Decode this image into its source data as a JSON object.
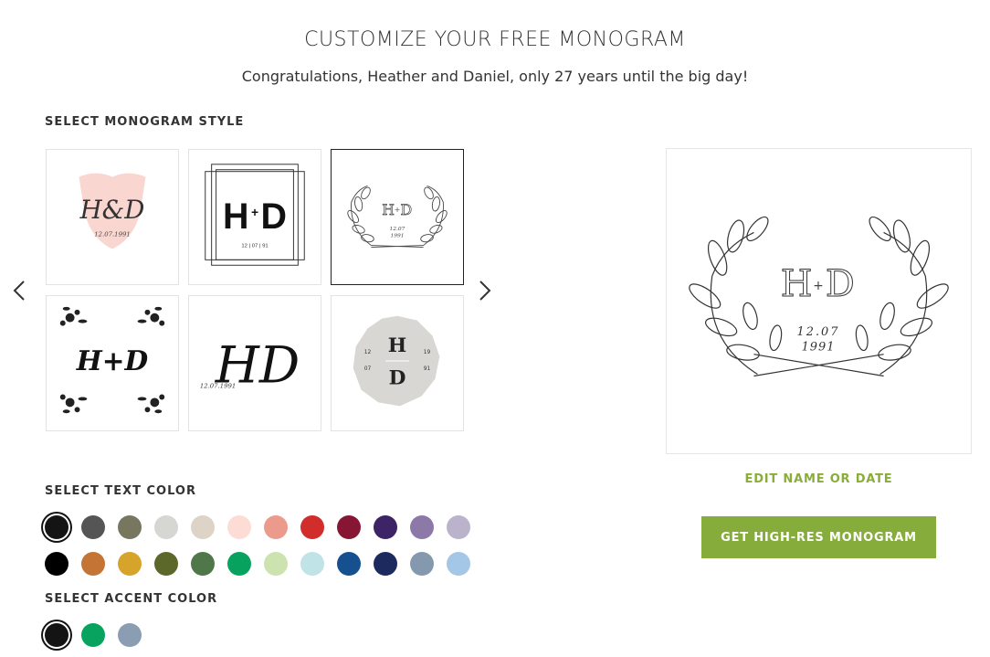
{
  "header": {
    "title": "CUSTOMIZE YOUR FREE MONOGRAM",
    "subtitle": "Congratulations, Heather and Daniel, only 27 years until the big day!"
  },
  "style_section": {
    "label": "SELECT MONOGRAM STYLE",
    "prev_icon": "chevron-left-icon",
    "next_icon": "chevron-right-icon",
    "selected_index": 2,
    "tiles": [
      {
        "name": "pink-shield",
        "initials": "H&D",
        "date": "12.07.1991"
      },
      {
        "name": "block-square",
        "initials_left": "H",
        "initials_right": "D",
        "plus": "+",
        "date": "12 | 07 | 91"
      },
      {
        "name": "laurel-wreath",
        "initials_left": "H",
        "initials_right": "D",
        "plus": "+",
        "date_top": "12.07",
        "date_bottom": "1991"
      },
      {
        "name": "floral-corners",
        "initials": "H+D"
      },
      {
        "name": "script-large",
        "initials": "HD",
        "date": "12.07.1991"
      },
      {
        "name": "grey-badge",
        "initial_top": "H",
        "initial_bottom": "D",
        "left_top": "12",
        "left_bottom": "07",
        "right_top": "19",
        "right_bottom": "91"
      }
    ]
  },
  "preview": {
    "initials_left": "H",
    "initials_right": "D",
    "plus": "+",
    "date_top": "12.07",
    "date_bottom": "1991"
  },
  "actions": {
    "edit_label": "EDIT NAME OR DATE",
    "cta_label": "GET HIGH-RES MONOGRAM"
  },
  "text_color": {
    "label": "SELECT TEXT COLOR",
    "selected_index": 0,
    "row1": [
      "#141414",
      "#555555",
      "#77775f",
      "#d6d6d3",
      "#ddd3c6",
      "#fcdcd5",
      "#ec9a8b",
      "#d02d2b",
      "#871634",
      "#3c2466",
      "#8c79a8",
      "#bbb3cb"
    ],
    "row2": [
      "#000000",
      "#c47535",
      "#d6a32b",
      "#5c6829",
      "#50774a",
      "#07a35e",
      "#cde3af",
      "#bfe3e7",
      "#17508e",
      "#1d2a5e",
      "#8599ae",
      "#a4c7e7"
    ]
  },
  "accent_color": {
    "label": "SELECT ACCENT COLOR",
    "selected_index": 0,
    "colors": [
      "#141414",
      "#08a35e",
      "#8a9db2"
    ]
  }
}
